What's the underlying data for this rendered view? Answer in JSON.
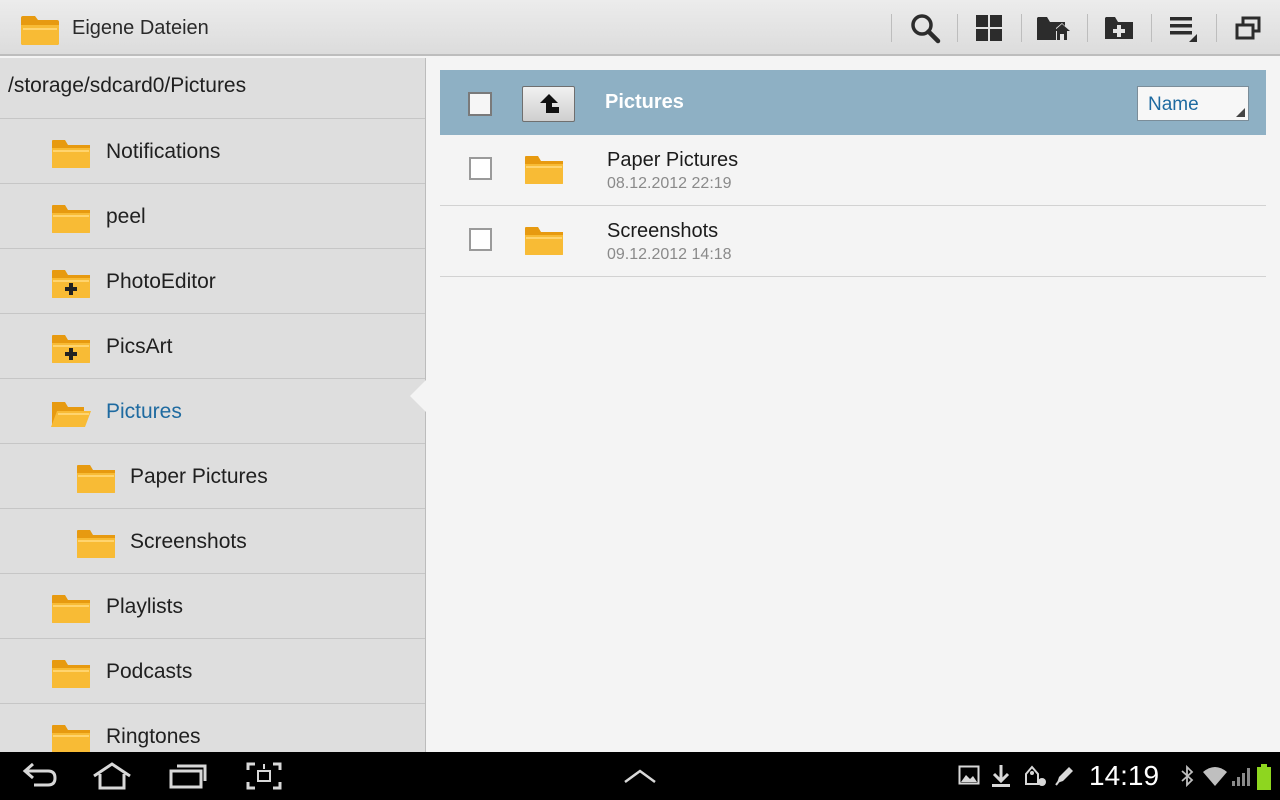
{
  "app": {
    "title": "Eigene Dateien"
  },
  "toolbar": {
    "icons": [
      "search-icon",
      "grid-view-icon",
      "home-folder-icon",
      "new-folder-icon",
      "list-options-icon",
      "multi-window-icon"
    ]
  },
  "sidebar": {
    "path": "/storage/sdcard0/Pictures",
    "items": [
      {
        "label": "Notifications",
        "indent": 0,
        "type": "folder"
      },
      {
        "label": "peel",
        "indent": 0,
        "type": "folder"
      },
      {
        "label": "PhotoEditor",
        "indent": 0,
        "type": "folder-plus"
      },
      {
        "label": "PicsArt",
        "indent": 0,
        "type": "folder-plus"
      },
      {
        "label": "Pictures",
        "indent": 0,
        "type": "folder-open",
        "active": true
      },
      {
        "label": "Paper Pictures",
        "indent": 1,
        "type": "folder"
      },
      {
        "label": "Screenshots",
        "indent": 1,
        "type": "folder"
      },
      {
        "label": "Playlists",
        "indent": 0,
        "type": "folder"
      },
      {
        "label": "Podcasts",
        "indent": 0,
        "type": "folder"
      },
      {
        "label": "Ringtones",
        "indent": 0,
        "type": "folder"
      }
    ]
  },
  "main": {
    "header_title": "Pictures",
    "sort_label": "Name",
    "files": [
      {
        "name": "Paper Pictures",
        "date": "08.12.2012 22:19"
      },
      {
        "name": "Screenshots",
        "date": "09.12.2012 14:18"
      }
    ]
  },
  "statusbar": {
    "time": "14:19"
  },
  "colors": {
    "accent": "#1e6aa0",
    "header_bar": "#8eb0c4",
    "folder": "#f7b42c"
  }
}
